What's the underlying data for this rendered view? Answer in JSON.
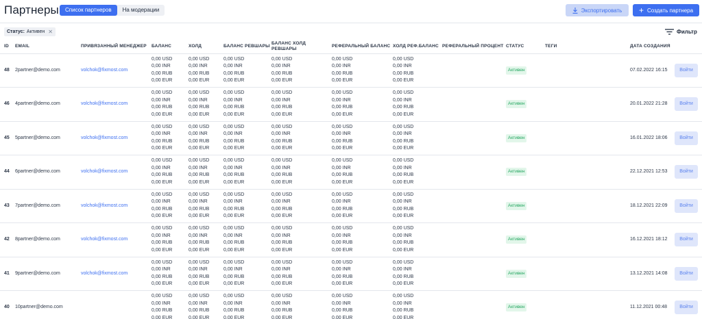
{
  "header": {
    "title": "Партнеры",
    "tabs": [
      {
        "label": "Список партнеров",
        "active": true
      },
      {
        "label": "На модерации",
        "active": false
      }
    ],
    "export_label": "Экспортировать",
    "create_label": "Создать партнера"
  },
  "filters": {
    "chip_key": "Статус:",
    "chip_value": "Активен",
    "filter_label": "Фильтр"
  },
  "colors": {
    "accent": "#3d6ff0",
    "status_bg": "#e2f6ea",
    "status_text": "#24a660"
  },
  "table": {
    "columns": {
      "id": "ID",
      "email": "EMAIL",
      "manager": "ПРИВЯЗАННЫЙ МЕНЕДЖЕР",
      "balance": "БАЛАНС",
      "hold": "ХОЛД",
      "balance_revshare": "БАЛАНС РЕВШАРЫ",
      "hold_revshare": "БАЛАНС ХОЛД РЕВШАРЫ",
      "ref_balance": "РЕФЕРАЛЬНЫЙ БАЛАНС",
      "hold_ref_balance": "ХОЛД РЕФ.БАЛАНС",
      "ref_percent": "РЕФЕРАЛЬНЫЙ ПРОЦЕНТ",
      "status": "СТАТУС",
      "tags": "ТЕГИ",
      "created": "ДАТА СОЗДАНИЯ"
    },
    "money": [
      "0,00 USD",
      "0,00 INR",
      "0,00 RUB",
      "0,00 EUR"
    ],
    "login_label": "Войти",
    "rows": [
      {
        "id": "48",
        "email": "2partner@demo.com",
        "manager": "volchok@fixmost.com",
        "status": "Активен",
        "created": "07.02.2022 16:15"
      },
      {
        "id": "46",
        "email": "4partner@demo.com",
        "manager": "volchok@fixmost.com",
        "status": "Активен",
        "created": "20.01.2022 21:28"
      },
      {
        "id": "45",
        "email": "5partner@demo.com",
        "manager": "volchok@fixmost.com",
        "status": "Активен",
        "created": "16.01.2022 18:06"
      },
      {
        "id": "44",
        "email": "6partner@demo.com",
        "manager": "volchok@fixmost.com",
        "status": "Активен",
        "created": "22.12.2021 12:53"
      },
      {
        "id": "43",
        "email": "7partner@demo.com",
        "manager": "volchok@fixmost.com",
        "status": "Активен",
        "created": "18.12.2021 22:09"
      },
      {
        "id": "42",
        "email": "8partner@demo.com",
        "manager": "volchok@fixmost.com",
        "status": "Активен",
        "created": "16.12.2021 18:12"
      },
      {
        "id": "41",
        "email": "9partner@demo.com",
        "manager": "volchok@fixmost.com",
        "status": "Активен",
        "created": "13.12.2021 14:08"
      },
      {
        "id": "40",
        "email": "10partner@demo.com",
        "manager": "",
        "status": "Активен",
        "created": "11.12.2021 00:48"
      }
    ]
  }
}
